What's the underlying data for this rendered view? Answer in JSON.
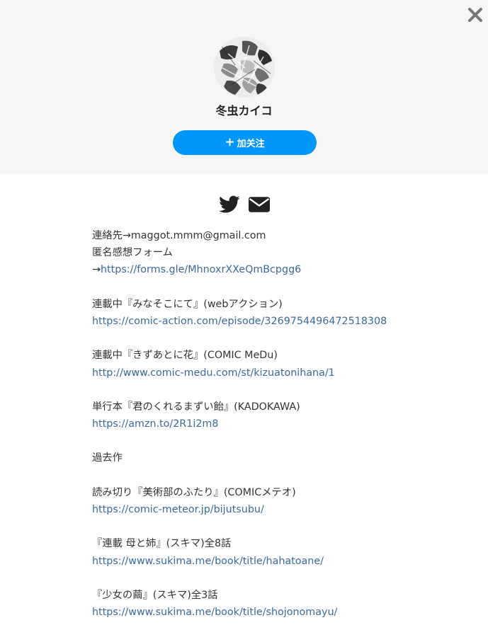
{
  "header": {
    "close_icon": "close-icon",
    "avatar_alt": "avatar",
    "name": "冬虫カイコ",
    "follow_plus": "+",
    "follow_label": "加关注"
  },
  "social": {
    "twitter_icon": "twitter-icon",
    "mail_icon": "mail-icon"
  },
  "bio": {
    "contact": "連絡先→maggot.mmm@gmail.com",
    "form_label": "匿名感想フォーム",
    "form_arrow": "→",
    "form_url": "https://forms.gle/MhnoxrXXeQmBcpgg6",
    "serial1_title": "連載中『みなそこにて』(webアクション)",
    "serial1_url": "https://comic-action.com/episode/3269754496472518308",
    "serial2_title": "連載中『きずあとに花』(COMIC MeDu)",
    "serial2_url": "http://www.comic-medu.com/st/kizuatonihana/1",
    "book_title": "単行本『君のくれるまずい飴』(KADOKAWA)",
    "book_url": "https://amzn.to/2R1i2m8",
    "past_works": "過去作",
    "past1_title": "読み切り『美術部のふたり』(COMICメテオ)",
    "past1_url": "https://comic-meteor.jp/bijutsubu/",
    "past2_title": "『連載 母と姉』(スキマ)全8話",
    "past2_url": "https://www.sukima.me/book/title/hahatoane/",
    "past3_title": "『少女の繭』(スキマ)全3話",
    "past3_url": "https://www.sukima.me/book/title/shojonomayu/"
  },
  "colors": {
    "header_bg": "#f6f6f6",
    "accent": "#0096fa",
    "link": "#3a6a9c",
    "text": "#333333"
  }
}
